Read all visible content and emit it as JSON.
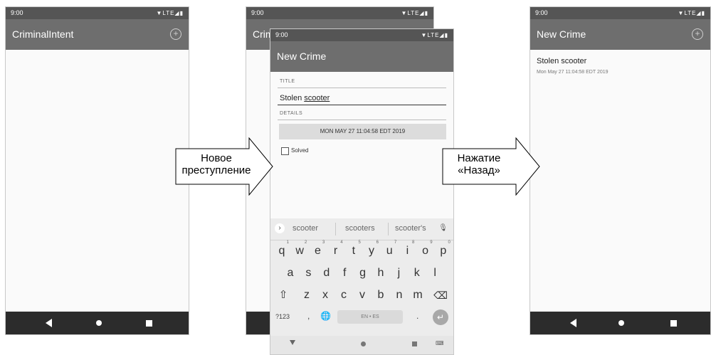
{
  "status_time": "9:00",
  "status_icons": "▼LTE◢▮",
  "screen1": {
    "title": "CriminalIntent"
  },
  "screen2_back": {
    "title": "CriminalIntent"
  },
  "screen2": {
    "title": "New Crime",
    "title_hint": "TITLE",
    "title_value_prefix": "Stolen ",
    "title_value_word": "scooter",
    "details_hint": "DETAILS",
    "date_button": "MON MAY 27 11:04:58 EDT 2019",
    "solved_label": "Solved",
    "keyboard": {
      "suggestions": [
        "scooter",
        "scooters",
        "scooter's"
      ],
      "row1": [
        [
          "q",
          "1"
        ],
        [
          "w",
          "2"
        ],
        [
          "e",
          "3"
        ],
        [
          "r",
          "4"
        ],
        [
          "t",
          "5"
        ],
        [
          "y",
          "6"
        ],
        [
          "u",
          "7"
        ],
        [
          "i",
          "8"
        ],
        [
          "o",
          "9"
        ],
        [
          "p",
          "0"
        ]
      ],
      "row2": [
        "a",
        "s",
        "d",
        "f",
        "g",
        "h",
        "j",
        "k",
        "l"
      ],
      "row3": [
        "z",
        "x",
        "c",
        "v",
        "b",
        "n",
        "m"
      ],
      "symbols_key": "?123",
      "comma_key": ",",
      "period_key": ".",
      "space_label": "EN • ES"
    }
  },
  "screen3": {
    "title": "New Crime",
    "item_title": "Stolen scooter",
    "item_date": "Mon May 27 11:04:58 EDT 2019"
  },
  "arrow1": {
    "line1": "Новое",
    "line2": "преступление"
  },
  "arrow2": {
    "line1": "Нажатие",
    "line2": "«Назад»"
  }
}
